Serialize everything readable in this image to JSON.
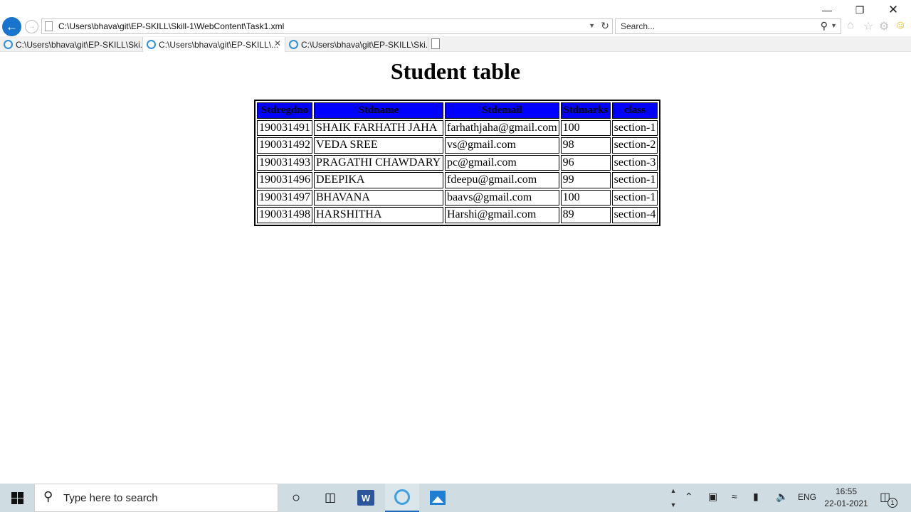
{
  "browser": {
    "address": "C:\\Users\\bhava\\git\\EP-SKILL\\Skill-1\\WebContent\\Task1.xml",
    "search_placeholder": "Search...",
    "tabs": [
      {
        "label": "C:\\Users\\bhava\\git\\EP-SKILL\\Ski..."
      },
      {
        "label": "C:\\Users\\bhava\\git\\EP-SKILL\\..."
      },
      {
        "label": "C:\\Users\\bhava\\git\\EP-SKILL\\Ski..."
      }
    ],
    "icons": [
      "back-arrow-icon",
      "forward-arrow-icon",
      "refresh-icon",
      "search-icon",
      "home-icon",
      "favorites-star-icon",
      "settings-gear-icon",
      "smiley-feedback-icon"
    ]
  },
  "page": {
    "title": "Student table",
    "header_bg": "#0000ff",
    "columns": [
      "Stdregdno",
      "Stdname",
      "Stdemail",
      "Stdmarks",
      "class"
    ],
    "rows": [
      [
        "190031491",
        "SHAIK FARHATH JAHA",
        "farhathjaha@gmail.com",
        "100",
        "section-1"
      ],
      [
        "190031492",
        "VEDA SREE",
        "vs@gmail.com",
        "98",
        "section-2"
      ],
      [
        "190031493",
        "PRAGATHI CHAWDARY",
        "pc@gmail.com",
        "96",
        "section-3"
      ],
      [
        "190031496",
        "DEEPIKA",
        "fdeepu@gmail.com",
        "99",
        "section-1"
      ],
      [
        "190031497",
        "BHAVANA",
        "baavs@gmail.com",
        "100",
        "section-1"
      ],
      [
        "190031498",
        "HARSHITHA",
        "Harshi@gmail.com",
        "89",
        "section-4"
      ]
    ]
  },
  "taskbar": {
    "search_placeholder": "Type here to search",
    "word_label": "W",
    "lang": "ENG",
    "time": "16:55",
    "date": "22-01-2021",
    "notification_count": "1"
  }
}
